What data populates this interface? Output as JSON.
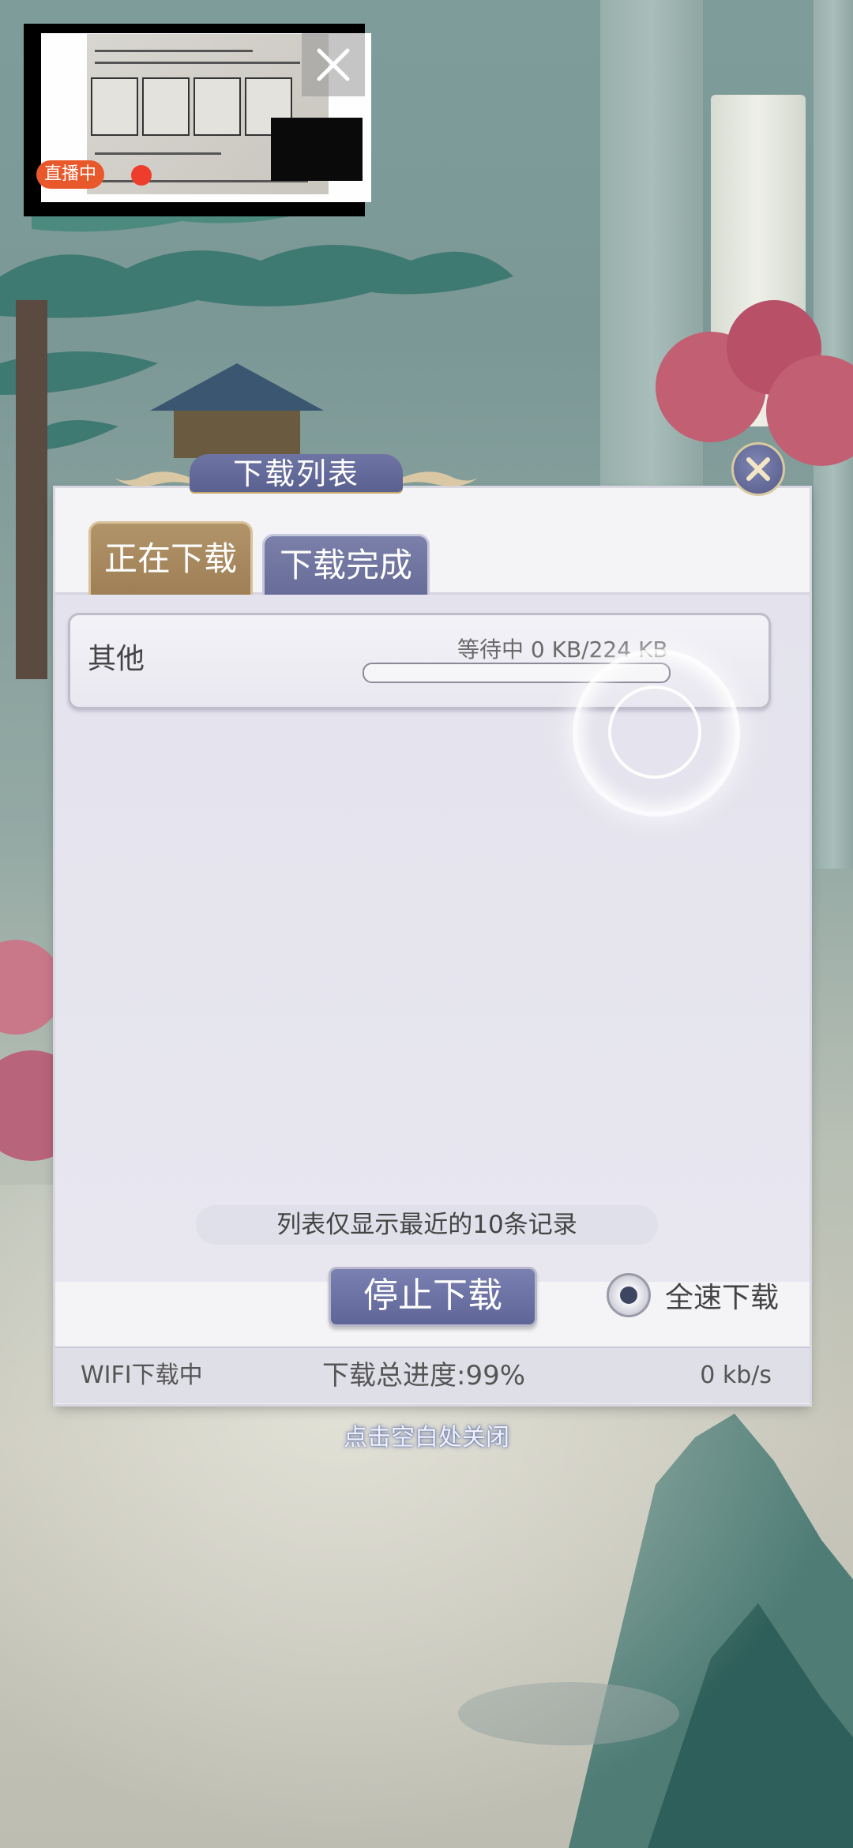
{
  "pip": {
    "live_label": "直播中"
  },
  "dialog": {
    "title": "下载列表",
    "tabs": [
      {
        "label": "正在下载",
        "active": true
      },
      {
        "label": "下载完成",
        "active": false
      }
    ],
    "items": [
      {
        "name": "其他",
        "status": "等待中 0 KB/224 KB",
        "progress": 0
      }
    ],
    "note": "列表仅显示最近的10条记录",
    "stop_button": "停止下载",
    "full_speed_label": "全速下载",
    "full_speed_selected": true,
    "status": {
      "network": "WIFI下载中",
      "total_progress": "下载总进度:99%",
      "speed": "0 kb/s"
    }
  },
  "close_hint": "点击空白处关闭",
  "colors": {
    "accent_purple": "#676c98",
    "accent_gold": "#a4855a",
    "panel_bg": "#ecebf2"
  }
}
